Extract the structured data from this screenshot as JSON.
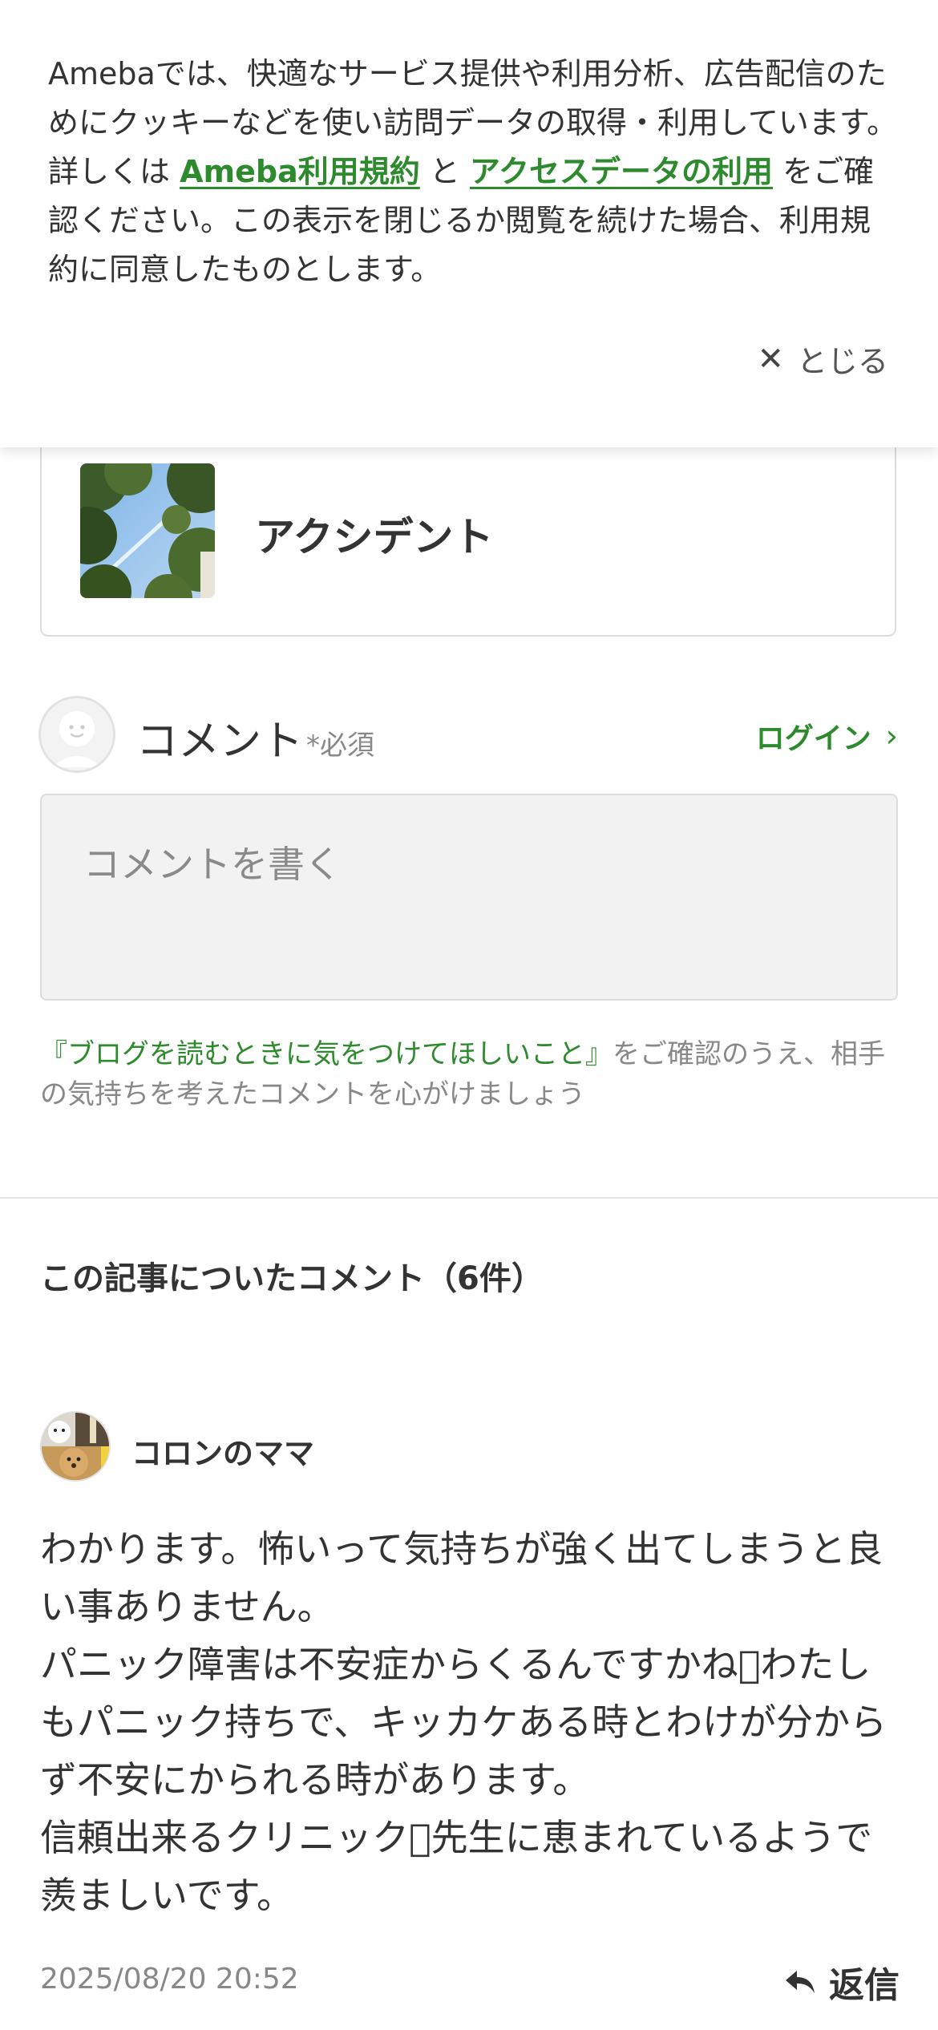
{
  "cookie_banner": {
    "text_before": "Amebaでは、快適なサービス提供や利用分析、広告配信のためにクッキーなどを使い訪問データの取得・利用しています。詳しくは ",
    "terms_link": "Ameba利用規約",
    "conjunction": " と ",
    "access_link": "アクセスデータの利用",
    "text_after": " をご確認ください。この表示を閉じるか閲覧を続けた場合、利用規約に同意したものとします。",
    "close_label": "とじる"
  },
  "article": {
    "title": "アクシデント"
  },
  "comment_form": {
    "label": "コメント",
    "required": "*必須",
    "login_label": "ログイン",
    "placeholder": "コメントを書く",
    "guideline_link": "『ブログを読むときに気をつけてほしいこと』",
    "guideline_text": "をご確認のうえ、相手の気持ちを考えたコメントを心がけましょう"
  },
  "comments": {
    "heading": "この記事についたコメント（6件）",
    "items": [
      {
        "author": "コロンのママ",
        "body": "わかります。怖いって気持ちが強く出てしまうと良い事ありません。\nパニック障害は不安症からくるんですかね􀀀わたしもパニック持ちで、キッカケある時とわけが分からず不安にかられる時があります。\n信頼出来るクリニック􀀀先生に恵まれているようで羨ましいです。",
        "date": "2025/08/20 20:52",
        "reply_label": "返信"
      }
    ]
  },
  "colors": {
    "link_green": "#2d8a2d",
    "text": "#333333",
    "muted": "#888888",
    "input_bg": "#f2f2f2",
    "border": "#dddddd"
  }
}
